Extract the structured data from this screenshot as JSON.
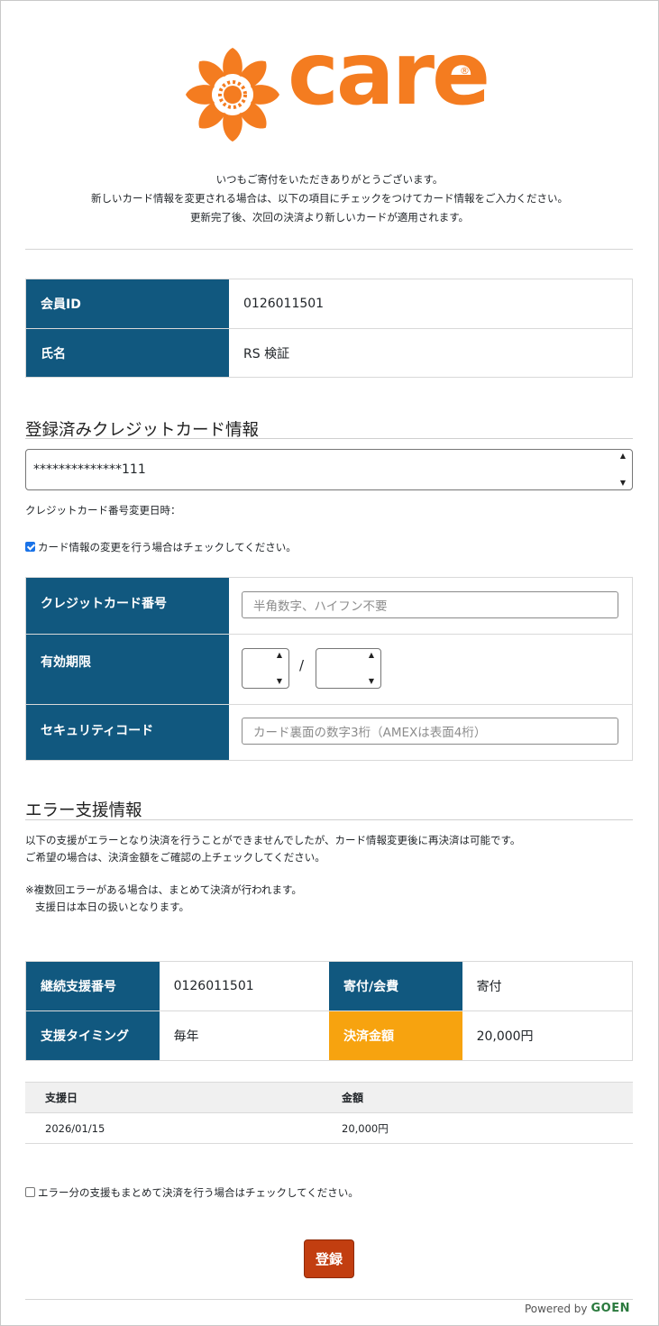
{
  "brand": {
    "name": "care",
    "registered": "®",
    "accent": "#f47c20"
  },
  "intro": {
    "line1": "いつもご寄付をいただきありがとうございます。",
    "line2": "新しいカード情報を変更される場合は、以下の項目にチェックをつけてカード情報をご入力ください。",
    "line3": "更新完了後、次回の決済より新しいカードが適用されます。"
  },
  "member": {
    "id_label": "会員ID",
    "id_value": "0126011501",
    "name_label": "氏名",
    "name_value": "RS 検証"
  },
  "registered_card": {
    "title": "登録済みクレジットカード情報",
    "selected": "**************111",
    "change_date_label": "クレジットカード番号変更日時：",
    "change_checkbox_label": "カード情報の変更を行う場合はチェックしてください。",
    "change_checked": true
  },
  "card_form": {
    "number_label": "クレジットカード番号",
    "number_placeholder": "半角数字、ハイフン不要",
    "expiry_label": "有効期限",
    "expiry_separator": "/",
    "cvc_label": "セキュリティコード",
    "cvc_placeholder": "カード裏面の数字3桁（AMEXは表面4桁）"
  },
  "error_section": {
    "title": "エラー支援情報",
    "desc1": "以下の支援がエラーとなり決済を行うことができませんでしたが、カード情報変更後に再決済は可能です。",
    "desc2": "ご希望の場合は、決済金額をご確認の上チェックしてください。",
    "note1": "※複数回エラーがある場合は、まとめて決済が行われます。",
    "note2": "支援日は本日の扱いとなります。"
  },
  "payment": {
    "support_no_label": "継続支援番号",
    "support_no_value": "0126011501",
    "type_label": "寄付/会費",
    "type_value": "寄付",
    "timing_label": "支援タイミング",
    "timing_value": "毎年",
    "amount_label": "決済金額",
    "amount_value": "20,000円"
  },
  "history": {
    "columns": [
      "支援日",
      "金額"
    ],
    "rows": [
      {
        "date": "2026/01/15",
        "amount": "20,000円"
      }
    ]
  },
  "error_checkbox_label": "エラー分の支援もまとめて決済を行う場合はチェックしてください。",
  "submit_label": "登録",
  "footer": {
    "powered_by": "Powered by",
    "provider": "GOEN"
  }
}
